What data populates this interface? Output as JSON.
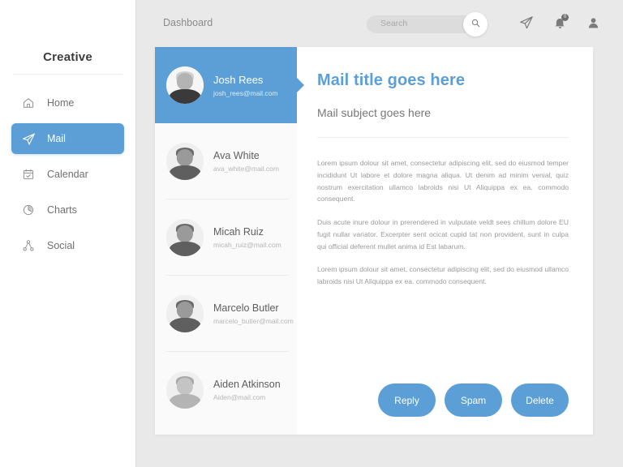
{
  "sidebar": {
    "brand": "Creative",
    "items": [
      {
        "label": "Home",
        "icon": "home-icon",
        "active": false
      },
      {
        "label": "Mail",
        "icon": "paper-plane-icon",
        "active": true
      },
      {
        "label": "Calendar",
        "icon": "calendar-icon",
        "active": false
      },
      {
        "label": "Charts",
        "icon": "pie-chart-icon",
        "active": false
      },
      {
        "label": "Social",
        "icon": "social-icon",
        "active": false
      }
    ]
  },
  "topbar": {
    "breadcrumb": "Dashboard",
    "search": {
      "placeholder": "Search",
      "value": "",
      "button_icon": "search-icon"
    },
    "icons": [
      {
        "name": "send-icon",
        "badge": ""
      },
      {
        "name": "notification-icon",
        "badge": "0"
      },
      {
        "name": "user-icon",
        "badge": ""
      }
    ]
  },
  "mail_list": [
    {
      "name": "Josh Rees",
      "email": "josh_rees@mail.com",
      "selected": true
    },
    {
      "name": "Ava White",
      "email": "ava_white@mail.com",
      "selected": false
    },
    {
      "name": "Micah Ruiz",
      "email": "micah_ruiz@mail.com",
      "selected": false
    },
    {
      "name": "Marcelo Butler",
      "email": "marcelo_butler@mail.com",
      "selected": false
    },
    {
      "name": "Aiden Atkinson",
      "email": "Aiden@mail.com",
      "selected": false
    }
  ],
  "reader": {
    "title": "Mail title goes here",
    "subject": "Mail subject goes here",
    "paragraphs": [
      "Lorem ipsum dolour sit amet, consectetur adipiscing elit, sed do eiusmod temper incididunt Ut labore et dolore magna aliqua. Ut denim ad minim venial, quiz nostrum exercitation ullamco labroids nisi Ut Aliquippa ex ea. commodo consequent.",
      "Duis acute inure dolour in prerendered in vulputate veldt sees chillum dolore EU fugit nullar variator. Excerpter sent ocicat cupid tat non provident, sunt in culpa qui official deferent mullet anima id Est labarum.",
      "Lorem ipsum dolour sit amet, consectetur adipiscing elit, sed do eiusmod ullamco labroids nisi Ut Aliquippa ex ea. commodo consequent."
    ],
    "buttons": [
      {
        "label": "Reply"
      },
      {
        "label": "Spam"
      },
      {
        "label": "Delete"
      }
    ]
  },
  "colors": {
    "accent": "#5b9fd6",
    "workspace_bg": "#e9e9e9",
    "card_bg": "#ffffff",
    "list_bg": "#fafafa",
    "text_muted": "#9a9a9a"
  }
}
